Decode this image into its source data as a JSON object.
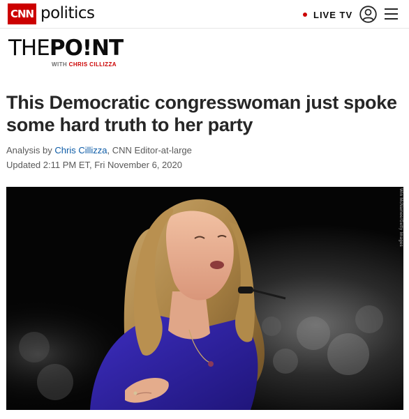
{
  "nav": {
    "logo_text": "CNN",
    "section": "politics",
    "live_label": "LIVE TV",
    "icons": [
      "user-account-icon",
      "hamburger-menu-icon"
    ],
    "accent_color": "#cc0000"
  },
  "point_logo": {
    "the": "THE",
    "point": "PO!NT",
    "with": "WITH ",
    "author": "CHRIS CILLIZZA"
  },
  "article": {
    "headline": "This Democratic congresswoman just spoke some hard truth to her party",
    "byline_prefix": "Analysis by ",
    "author": "Chris Cillizza",
    "author_title": ", CNN Editor-at-large",
    "updated": "Updated 2:11 PM ET, Fri November 6, 2020"
  },
  "hero": {
    "photo_credit": "Win McNamee/Getty Images"
  }
}
